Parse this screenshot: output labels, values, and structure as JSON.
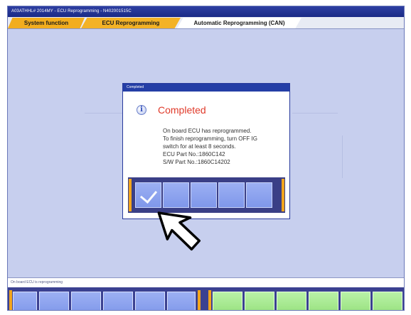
{
  "window": {
    "title": "A03ATHHL# 2014MY  -  ECU Reprogramming  -  N402001515C"
  },
  "tabs": [
    {
      "label": "System function"
    },
    {
      "label": "ECU Reprogramming"
    },
    {
      "label": "Automatic Reprogramming (CAN)"
    }
  ],
  "dialog": {
    "title": "Completed",
    "heading": "Completed",
    "icon": "info-icon",
    "message_lines": [
      "On board ECU has reprogrammed.",
      "To finish reprogramming, turn OFF IG",
      "switch for at least 8 seconds.",
      "ECU Part No.:1860C142",
      "S/W Part No.:1860C14202"
    ],
    "confirm_icon": "check-icon"
  },
  "status": {
    "text": "On board ECU is reprogramming"
  },
  "colors": {
    "accent_orange": "#f2a51c",
    "heading_red": "#e03a2a",
    "titlebar_blue": "#243ea6",
    "button_blue": "#8fa4f0",
    "button_green": "#a9eb92"
  }
}
